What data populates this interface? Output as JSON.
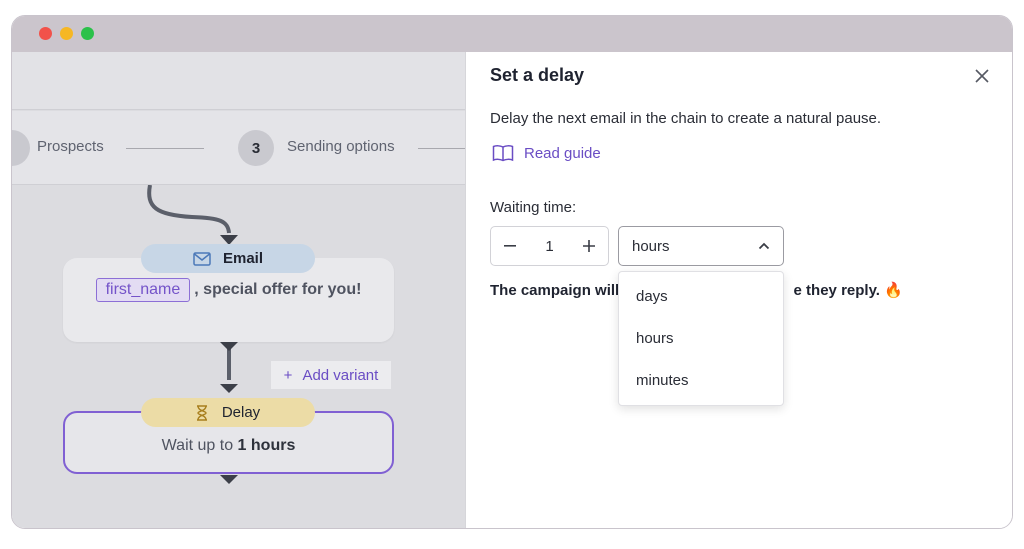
{
  "canvas": {
    "steps": [
      {
        "label": "Prospects"
      },
      {
        "number": "3",
        "label": "Sending options"
      }
    ],
    "email_node": {
      "title": "Email",
      "tag": "first_name",
      "text": ", special offer for you!",
      "icon": "envelope-icon"
    },
    "add_variant_label": "Add variant",
    "delay_node": {
      "title": "Delay",
      "text_prefix": "Wait up to ",
      "text_value": "1 hours",
      "icon": "hourglass-icon"
    }
  },
  "panel": {
    "title": "Set a delay",
    "description": "Delay the next email in the chain to create a natural pause.",
    "guide_label": "Read guide",
    "waiting_label": "Waiting time:",
    "quantity": "1",
    "unit": "hours",
    "campaign_text_start": "The campaign will",
    "campaign_text_end": "e they reply.",
    "campaign_emoji": "🔥",
    "options": [
      "days",
      "hours",
      "minutes"
    ]
  },
  "colors": {
    "accent": "#6a4dc4",
    "delay_border": "#8060d3",
    "email_pill": "#c7d6e6",
    "delay_pill": "#ecdca6"
  }
}
